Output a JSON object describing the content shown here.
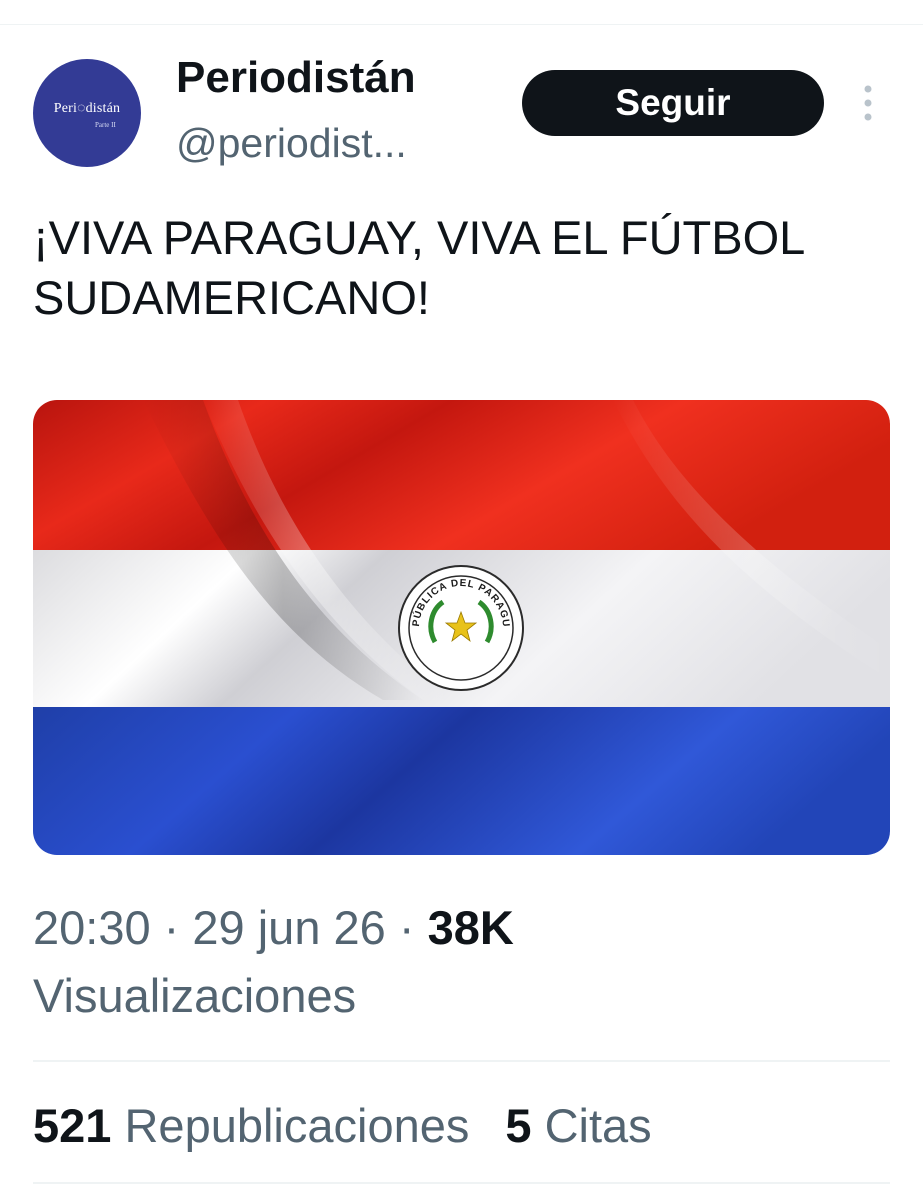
{
  "author": {
    "display_name": "Periodistán",
    "handle": "@periodist...",
    "avatar_logo": "Peri◌distán",
    "avatar_sub": "Parte II"
  },
  "follow_button": "Seguir",
  "more_icon": "more-vertical-icon",
  "tweet": {
    "text": "¡VIVA PARAGUAY, VIVA EL FÚTBOL SUDAMERICANO!"
  },
  "media": {
    "seal_text": "REPÚBLICA DEL PARAGUAY",
    "colors": {
      "red": "#d52b1e",
      "white": "#f2f2f2",
      "blue": "#0038a8"
    }
  },
  "meta": {
    "time": "20:30",
    "date": "29 jun 26",
    "separator": " · ",
    "views_count": "38K",
    "views_label": "Visualizaciones"
  },
  "stats": {
    "reposts_count": "521",
    "reposts_label": "Republicaciones",
    "quotes_count": "5",
    "quotes_label": "Citas"
  },
  "colors": {
    "text_primary": "#0f1419",
    "text_secondary": "#536471",
    "button_bg": "#0f1419",
    "avatar_bg": "#333b95"
  }
}
